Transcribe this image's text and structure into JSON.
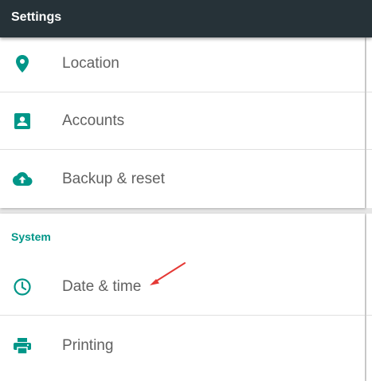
{
  "appbar": {
    "title": "Settings"
  },
  "accent_color": "#009688",
  "personal": {
    "items": [
      {
        "label": "Location",
        "icon": "location-pin-icon"
      },
      {
        "label": "Accounts",
        "icon": "account-box-icon"
      },
      {
        "label": "Backup & reset",
        "icon": "cloud-upload-icon"
      }
    ]
  },
  "system": {
    "header": "System",
    "items": [
      {
        "label": "Date & time",
        "icon": "clock-icon"
      },
      {
        "label": "Printing",
        "icon": "printer-icon"
      }
    ]
  },
  "annotation": {
    "type": "arrow",
    "color": "#e53935",
    "points_to": "Date & time"
  }
}
